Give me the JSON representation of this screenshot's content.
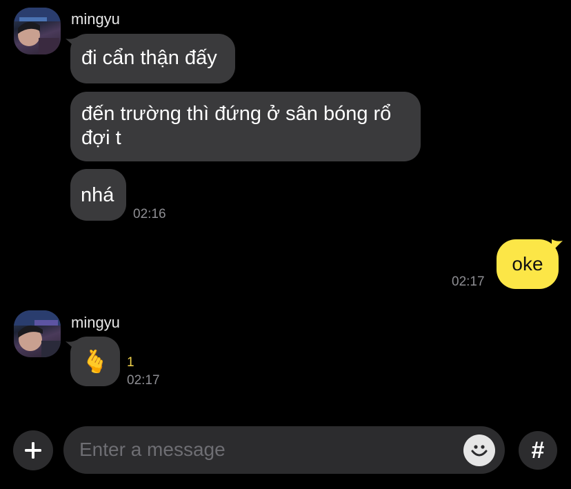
{
  "messages": {
    "group1": {
      "sender": "mingyu",
      "bubble1": "đi cẩn thận đấy",
      "bubble2_line1": "đến trường thì đứng ở sân bóng rổ",
      "bubble2_line2": "đợi t",
      "bubble3": "nhá",
      "time": "02:16"
    },
    "outgoing": {
      "text": "oke",
      "time": "02:17"
    },
    "group2": {
      "sender": "mingyu",
      "emoji": "🫰",
      "unread_count": "1",
      "time": "02:17"
    }
  },
  "composer": {
    "placeholder": "Enter a message",
    "hash_label": "#"
  },
  "colors": {
    "background": "#000000",
    "incoming_bubble": "#3a3a3c",
    "outgoing_bubble": "#fce647",
    "unread": "#f2d34b"
  }
}
